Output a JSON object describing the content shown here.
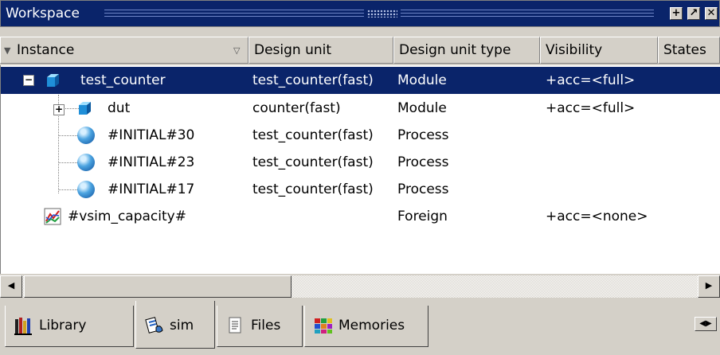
{
  "window": {
    "title": "Workspace",
    "buttons": [
      "+",
      "↗",
      "✕"
    ]
  },
  "columns": [
    {
      "label": "Instance"
    },
    {
      "label": "Design unit"
    },
    {
      "label": "Design unit type"
    },
    {
      "label": "Visibility"
    },
    {
      "label": "States"
    }
  ],
  "rows": [
    {
      "instance": "test_counter",
      "design_unit": "test_counter(fast)",
      "type": "Module",
      "visibility": "+acc=<full>",
      "icon": "module-icon",
      "expander": "−"
    },
    {
      "instance": "dut",
      "design_unit": "counter(fast)",
      "type": "Module",
      "visibility": "+acc=<full>",
      "icon": "module-icon",
      "expander": "+"
    },
    {
      "instance": "#INITIAL#30",
      "design_unit": "test_counter(fast)",
      "type": "Process",
      "visibility": "",
      "icon": "process-icon"
    },
    {
      "instance": "#INITIAL#23",
      "design_unit": "test_counter(fast)",
      "type": "Process",
      "visibility": "",
      "icon": "process-icon"
    },
    {
      "instance": "#INITIAL#17",
      "design_unit": "test_counter(fast)",
      "type": "Process",
      "visibility": "",
      "icon": "process-icon"
    },
    {
      "instance": "#vsim_capacity#",
      "design_unit": "",
      "type": "Foreign",
      "visibility": "+acc=<none>",
      "icon": "capacity-chart-icon"
    }
  ],
  "tabs": [
    {
      "label": "Library",
      "icon": "library-icon"
    },
    {
      "label": "sim",
      "icon": "sim-icon"
    },
    {
      "label": "Files",
      "icon": "files-icon"
    },
    {
      "label": "Memories",
      "icon": "memories-icon"
    }
  ],
  "colors": {
    "selection": "#0a246a",
    "face": "#d4d0c8"
  }
}
